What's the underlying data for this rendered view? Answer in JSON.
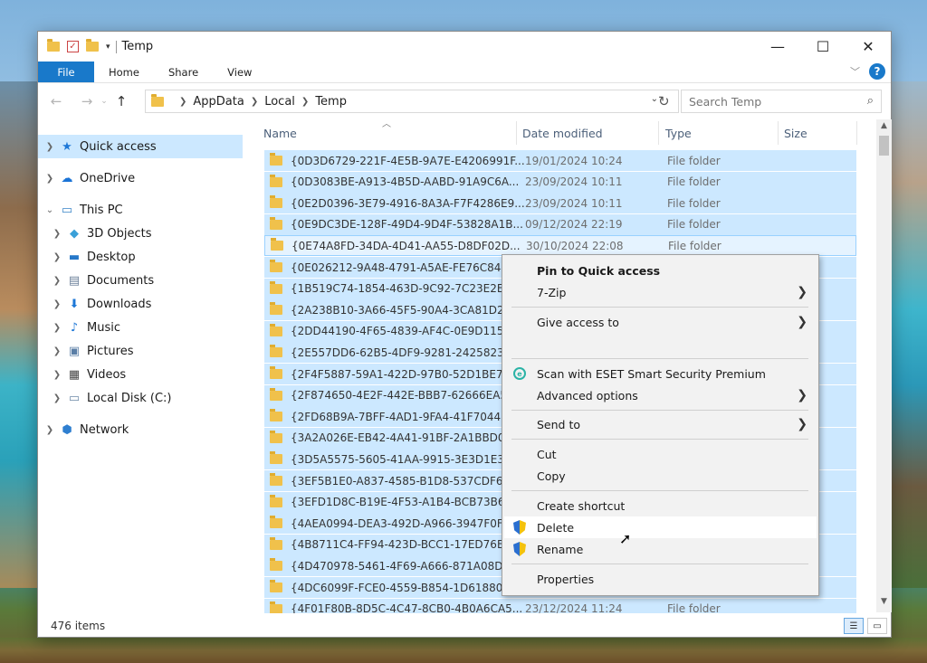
{
  "window": {
    "title": "Temp",
    "controls": {
      "minimize": "—",
      "maximize": "☐",
      "close": "✕"
    }
  },
  "ribbon": {
    "tabs": [
      "File",
      "Home",
      "Share",
      "View"
    ],
    "help": "?"
  },
  "address": {
    "breadcrumbs": [
      "AppData",
      "Local",
      "Temp"
    ],
    "search_placeholder": "Search Temp"
  },
  "nav_pane": {
    "items": [
      {
        "label": "Quick access",
        "icon": "star-icon"
      },
      {
        "label": "OneDrive",
        "icon": "cloud-icon"
      },
      {
        "label": "This PC",
        "icon": "computer-icon"
      },
      {
        "label": "3D Objects",
        "icon": "cube-icon"
      },
      {
        "label": "Desktop",
        "icon": "desktop-icon"
      },
      {
        "label": "Documents",
        "icon": "document-icon"
      },
      {
        "label": "Downloads",
        "icon": "download-icon"
      },
      {
        "label": "Music",
        "icon": "music-icon"
      },
      {
        "label": "Pictures",
        "icon": "picture-icon"
      },
      {
        "label": "Videos",
        "icon": "video-icon"
      },
      {
        "label": "Local Disk (C:)",
        "icon": "drive-icon"
      },
      {
        "label": "Network",
        "icon": "network-icon"
      }
    ]
  },
  "columns": {
    "name": "Name",
    "date": "Date modified",
    "type": "Type",
    "size": "Size"
  },
  "files": [
    {
      "name": "{0D3D6729-221F-4E5B-9A7E-E4206991F...",
      "date": "19/01/2024 10:24",
      "type": "File folder"
    },
    {
      "name": "{0D3083BE-A913-4B5D-AABD-91A9C6A...",
      "date": "23/09/2024 10:11",
      "type": "File folder"
    },
    {
      "name": "{0E2D0396-3E79-4916-8A3A-F7F4286E9...",
      "date": "23/09/2024 10:11",
      "type": "File folder"
    },
    {
      "name": "{0E9DC3DE-128F-49D4-9D4F-53828A1B...",
      "date": "09/12/2024 22:19",
      "type": "File folder"
    },
    {
      "name": "{0E74A8FD-34DA-4D41-AA55-D8DF02D...",
      "date": "30/10/2024 22:08",
      "type": "File folder"
    },
    {
      "name": "{0E026212-9A48-4791-A5AE-FE76C8441...",
      "date": "",
      "type": ""
    },
    {
      "name": "{1B519C74-1854-463D-9C92-7C23E2E12...",
      "date": "",
      "type": ""
    },
    {
      "name": "{2A238B10-3A66-45F5-90A4-3CA81D282...",
      "date": "",
      "type": ""
    },
    {
      "name": "{2DD44190-4F65-4839-AF4C-0E9D11509...",
      "date": "",
      "type": ""
    },
    {
      "name": "{2E557DD6-62B5-4DF9-9281-2425823A2...",
      "date": "",
      "type": ""
    },
    {
      "name": "{2F4F5887-59A1-422D-97B0-52D1BE737...",
      "date": "",
      "type": ""
    },
    {
      "name": "{2F874650-4E2F-442E-BBB7-62666EA54C...",
      "date": "",
      "type": ""
    },
    {
      "name": "{2FD68B9A-7BFF-4AD1-9FA4-41F704453...",
      "date": "",
      "type": ""
    },
    {
      "name": "{3A2A026E-EB42-4A41-91BF-2A1BBD0C...",
      "date": "",
      "type": ""
    },
    {
      "name": "{3D5A5575-5605-41AA-9915-3E3D1E3E9...",
      "date": "",
      "type": ""
    },
    {
      "name": "{3EF5B1E0-A837-4585-B1D8-537CDF652...",
      "date": "",
      "type": ""
    },
    {
      "name": "{3EFD1D8C-B19E-4F53-A1B4-BCB73B6B...",
      "date": "",
      "type": ""
    },
    {
      "name": "{4AEA0994-DEA3-492D-A966-3947F0F1F...",
      "date": "",
      "type": ""
    },
    {
      "name": "{4B8711C4-FF94-423D-BCC1-17ED76B4E...",
      "date": "",
      "type": ""
    },
    {
      "name": "{4D470978-5461-4F69-A666-871A08DF4...",
      "date": "",
      "type": ""
    },
    {
      "name": "{4DC6099F-FCE0-4559-B854-1D61880B4...",
      "date": "",
      "type": ""
    },
    {
      "name": "{4F01F80B-8D5C-4C47-8CB0-4B0A6CA5...",
      "date": "23/12/2024 11:24",
      "type": "File folder"
    }
  ],
  "context_menu": {
    "pin": "Pin to Quick access",
    "seven_zip": "7-Zip",
    "give_access": "Give access to",
    "scan": "Scan with ESET Smart Security Premium",
    "advanced": "Advanced options",
    "send_to": "Send to",
    "cut": "Cut",
    "copy": "Copy",
    "create_shortcut": "Create shortcut",
    "delete": "Delete",
    "rename": "Rename",
    "properties": "Properties",
    "submenu_arrow": "❯"
  },
  "status": {
    "item_count": "476 items"
  },
  "colors": {
    "accent": "#1979ca",
    "selection": "#cce8ff",
    "menu_bg": "#f2f2f2"
  }
}
